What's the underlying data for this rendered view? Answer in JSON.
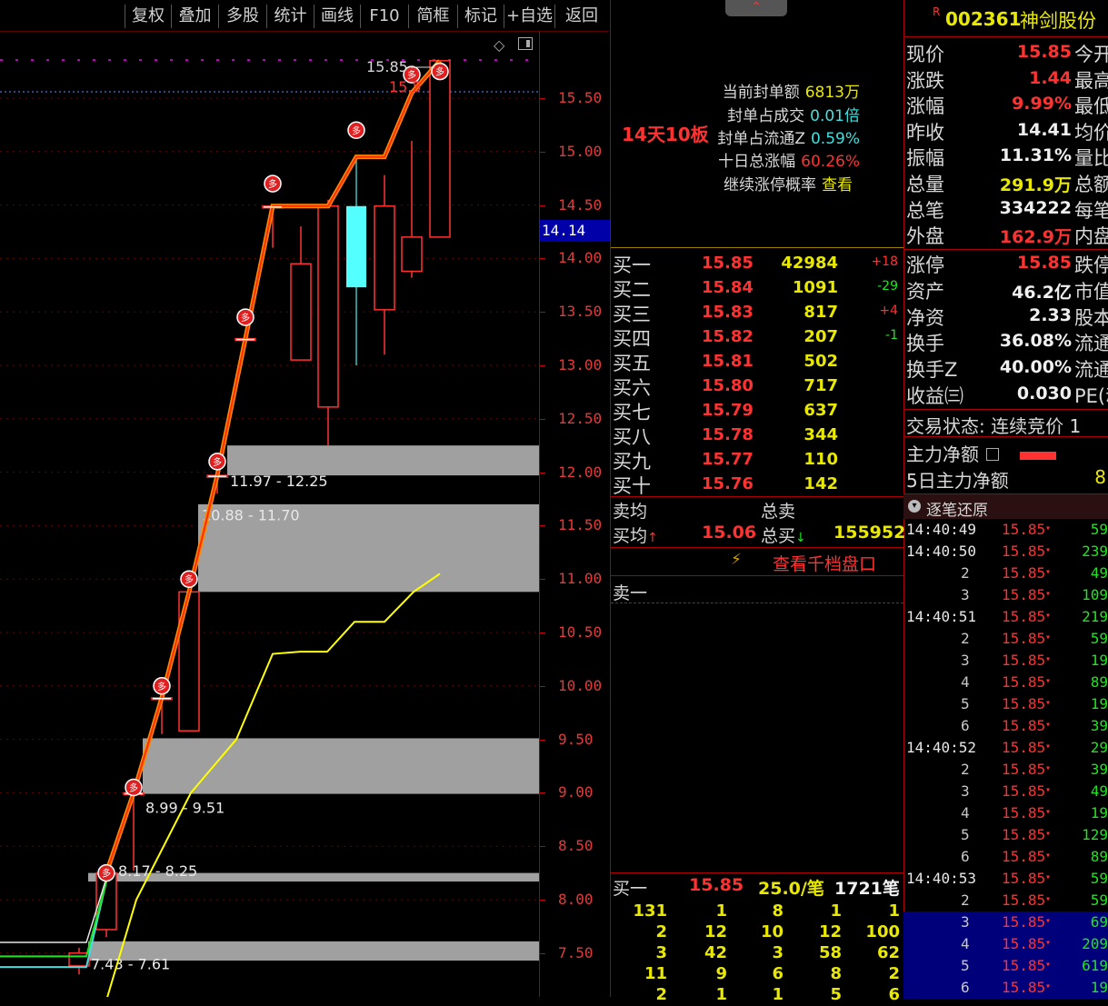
{
  "toolbar": {
    "buttons": [
      "复权",
      "叠加",
      "多股",
      "统计",
      "画线",
      "F10",
      "简框",
      "标记",
      "+自选",
      "返回"
    ]
  },
  "chart": {
    "y_ticks": [
      "15.50",
      "15.00",
      "14.50",
      "14.00",
      "13.50",
      "13.00",
      "12.50",
      "12.00",
      "11.50",
      "11.00",
      "10.50",
      "10.00",
      "9.50",
      "9.00",
      "8.50",
      "8.00",
      "7.50"
    ],
    "current_price": "14.14",
    "top_price_label": "15.85",
    "top_price_label2": "15.5",
    "zones": [
      {
        "label": "11.97 - 12.25",
        "low": 11.97,
        "high": 12.25
      },
      {
        "label": "10.88 - 11.70",
        "low": 10.88,
        "high": 11.7
      },
      {
        "label": "8.99 - 9.51",
        "low": 8.99,
        "high": 9.51
      },
      {
        "label": "8.17 - 8.25",
        "low": 8.17,
        "high": 8.25
      },
      {
        "label": "7.43 - 7.61",
        "low": 7.43,
        "high": 7.61
      }
    ],
    "marker_text": "多",
    "colors": {
      "up": "#ff3232",
      "down": "#54ffff",
      "ma": "#ffff00",
      "stair": "#ff8c00",
      "zone": "#a0a0a0"
    }
  },
  "mid": {
    "board_label": "14天10板",
    "seal_info": [
      {
        "k": "当前封单额",
        "v": "6813万",
        "color": "#e8e800"
      },
      {
        "k": "封单占成交",
        "v": "0.01倍",
        "color": "#40e0e0"
      },
      {
        "k": "封单占流通Z",
        "v": "0.59%",
        "color": "#40e0e0"
      },
      {
        "k": "十日总涨幅",
        "v": "60.26%",
        "color": "#ff3232"
      },
      {
        "k": "继续涨停概率",
        "v": "查看",
        "color": "#e8e800"
      }
    ],
    "bids": [
      {
        "name": "买一",
        "price": "15.85",
        "vol": "42984",
        "chg": "+18"
      },
      {
        "name": "买二",
        "price": "15.84",
        "vol": "1091",
        "chg": "-29"
      },
      {
        "name": "买三",
        "price": "15.83",
        "vol": "817",
        "chg": "+4"
      },
      {
        "name": "买四",
        "price": "15.82",
        "vol": "207",
        "chg": "-1"
      },
      {
        "name": "买五",
        "price": "15.81",
        "vol": "502",
        "chg": ""
      },
      {
        "name": "买六",
        "price": "15.80",
        "vol": "717",
        "chg": ""
      },
      {
        "name": "买七",
        "price": "15.79",
        "vol": "637",
        "chg": ""
      },
      {
        "name": "买八",
        "price": "15.78",
        "vol": "344",
        "chg": ""
      },
      {
        "name": "买九",
        "price": "15.77",
        "vol": "110",
        "chg": ""
      },
      {
        "name": "买十",
        "price": "15.76",
        "vol": "142",
        "chg": ""
      }
    ],
    "sell_avg_label": "卖均",
    "sell_total_label": "总卖",
    "buy_avg_label": "买均",
    "buy_avg_value": "15.06",
    "buy_total_label": "总买",
    "buy_total_value": "155952",
    "thousand_link": "查看千档盘口",
    "sell_one": "卖一",
    "bottom_head": {
      "name": "买一",
      "price": "15.85",
      "per": "25.0/笔",
      "count": "1721笔"
    },
    "bottom_grid": [
      [
        "131",
        "1",
        "8",
        "1",
        "1"
      ],
      [
        "2",
        "12",
        "10",
        "12",
        "100"
      ],
      [
        "3",
        "42",
        "3",
        "58",
        "62"
      ],
      [
        "11",
        "9",
        "6",
        "8",
        "2"
      ],
      [
        "2",
        "1",
        "1",
        "5",
        "6"
      ]
    ]
  },
  "right": {
    "code": "002361",
    "name": "神剑股份",
    "quote": [
      {
        "l": "现价",
        "v": "15.85",
        "c": "#ff3232",
        "l2": "今开"
      },
      {
        "l": "涨跌",
        "v": "1.44",
        "c": "#ff3232",
        "l2": "最高"
      },
      {
        "l": "涨幅",
        "v": "9.99%",
        "c": "#ff3232",
        "l2": "最低"
      },
      {
        "l": "昨收",
        "v": "14.41",
        "c": "#f0f0f0",
        "l2": "均价"
      },
      {
        "l": "振幅",
        "v": "11.31%",
        "c": "#f0f0f0",
        "l2": "量比"
      },
      {
        "l": "总量",
        "v": "291.9万",
        "c": "#e8e800",
        "l2": "总额"
      },
      {
        "l": "总笔",
        "v": "334222",
        "c": "#f0f0f0",
        "l2": "每笔"
      },
      {
        "l": "外盘",
        "v": "162.9万",
        "c": "#ff3232",
        "l2": "内盘"
      }
    ],
    "quote2": [
      {
        "l": "涨停",
        "v": "15.85",
        "c": "#ff3232",
        "l2": "跌停"
      },
      {
        "l": "资产",
        "v": "46.2亿",
        "c": "#f0f0f0",
        "l2": "市值"
      },
      {
        "l": "净资",
        "v": "2.33",
        "c": "#f0f0f0",
        "l2": "股本"
      },
      {
        "l": "换手",
        "v": "36.08%",
        "c": "#f0f0f0",
        "l2": "流通"
      },
      {
        "l": "换手Z",
        "v": "40.00%",
        "c": "#f0f0f0",
        "l2": "流通"
      },
      {
        "l": "收益㈢",
        "v": "0.030",
        "c": "#f0f0f0",
        "l2": "PE(动"
      }
    ],
    "trade_status": "交易状态: 连续竞价 1",
    "main_net": "主力净额",
    "main_net5": "5日主力净额",
    "main_net5_val": "8",
    "ticks_title": "逐笔还原",
    "ticks": [
      {
        "t": "14:40:49",
        "p": "15.85",
        "v": "59",
        "hl": false
      },
      {
        "t": "14:40:50",
        "p": "15.85",
        "v": "239",
        "hl": false
      },
      {
        "t": "2",
        "p": "15.85",
        "v": "49",
        "hl": false
      },
      {
        "t": "3",
        "p": "15.85",
        "v": "109",
        "hl": false
      },
      {
        "t": "14:40:51",
        "p": "15.85",
        "v": "219",
        "hl": false
      },
      {
        "t": "2",
        "p": "15.85",
        "v": "59",
        "hl": false
      },
      {
        "t": "3",
        "p": "15.85",
        "v": "19",
        "hl": false
      },
      {
        "t": "4",
        "p": "15.85",
        "v": "89",
        "hl": false
      },
      {
        "t": "5",
        "p": "15.85",
        "v": "19",
        "hl": false
      },
      {
        "t": "6",
        "p": "15.85",
        "v": "39",
        "hl": false
      },
      {
        "t": "14:40:52",
        "p": "15.85",
        "v": "29",
        "hl": false
      },
      {
        "t": "2",
        "p": "15.85",
        "v": "39",
        "hl": false
      },
      {
        "t": "3",
        "p": "15.85",
        "v": "49",
        "hl": false
      },
      {
        "t": "4",
        "p": "15.85",
        "v": "19",
        "hl": false
      },
      {
        "t": "5",
        "p": "15.85",
        "v": "129",
        "hl": false
      },
      {
        "t": "6",
        "p": "15.85",
        "v": "89",
        "hl": false
      },
      {
        "t": "14:40:53",
        "p": "15.85",
        "v": "59",
        "hl": false
      },
      {
        "t": "2",
        "p": "15.85",
        "v": "59",
        "hl": false
      },
      {
        "t": "3",
        "p": "15.85",
        "v": "69",
        "hl": true
      },
      {
        "t": "4",
        "p": "15.85",
        "v": "209",
        "hl": true
      },
      {
        "t": "5",
        "p": "15.85",
        "v": "619",
        "hl": true
      },
      {
        "t": "6",
        "p": "15.85",
        "v": "19",
        "hl": true
      }
    ]
  }
}
